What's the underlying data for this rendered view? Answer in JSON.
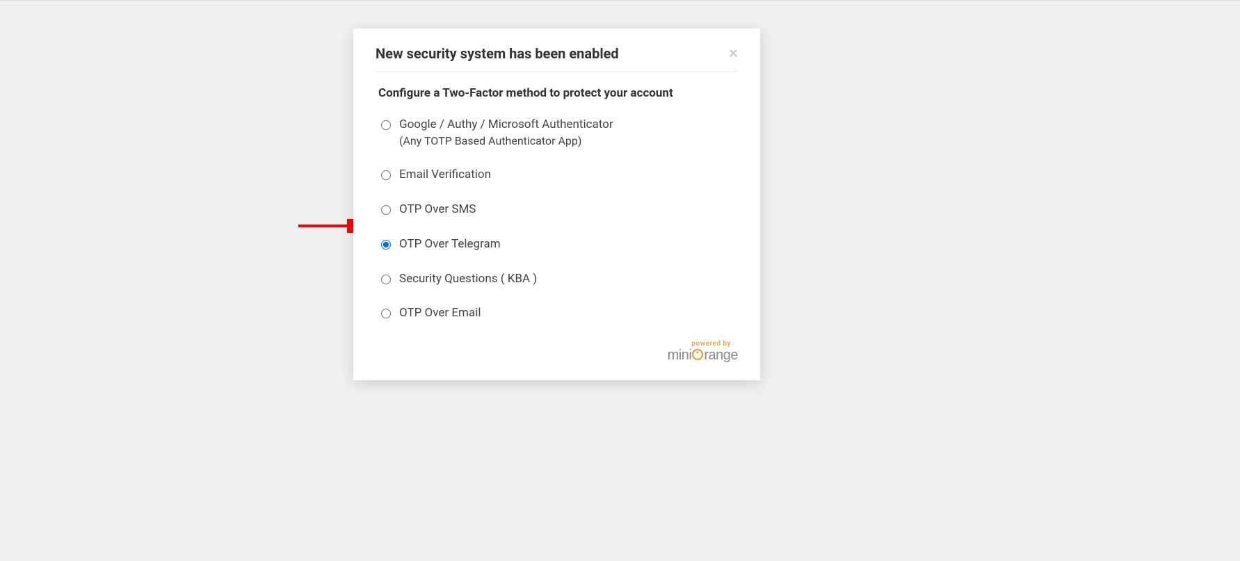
{
  "modal": {
    "title": "New security system has been enabled",
    "close_label": "×",
    "subtitle": "Configure a Two-Factor method to protect your account",
    "options": [
      {
        "label": "Google / Authy / Microsoft Authenticator",
        "sublabel": "(Any TOTP Based Authenticator App)",
        "checked": false
      },
      {
        "label": "Email Verification",
        "checked": false
      },
      {
        "label": "OTP Over SMS",
        "checked": false
      },
      {
        "label": "OTP Over Telegram",
        "checked": true
      },
      {
        "label": "Security Questions ( KBA )",
        "checked": false
      },
      {
        "label": "OTP Over Email",
        "checked": false
      }
    ],
    "footer": {
      "powered_by": "powered by",
      "brand_pre": "mini",
      "brand_post": "range"
    }
  },
  "annotation": {
    "arrow_target_index": 3
  }
}
